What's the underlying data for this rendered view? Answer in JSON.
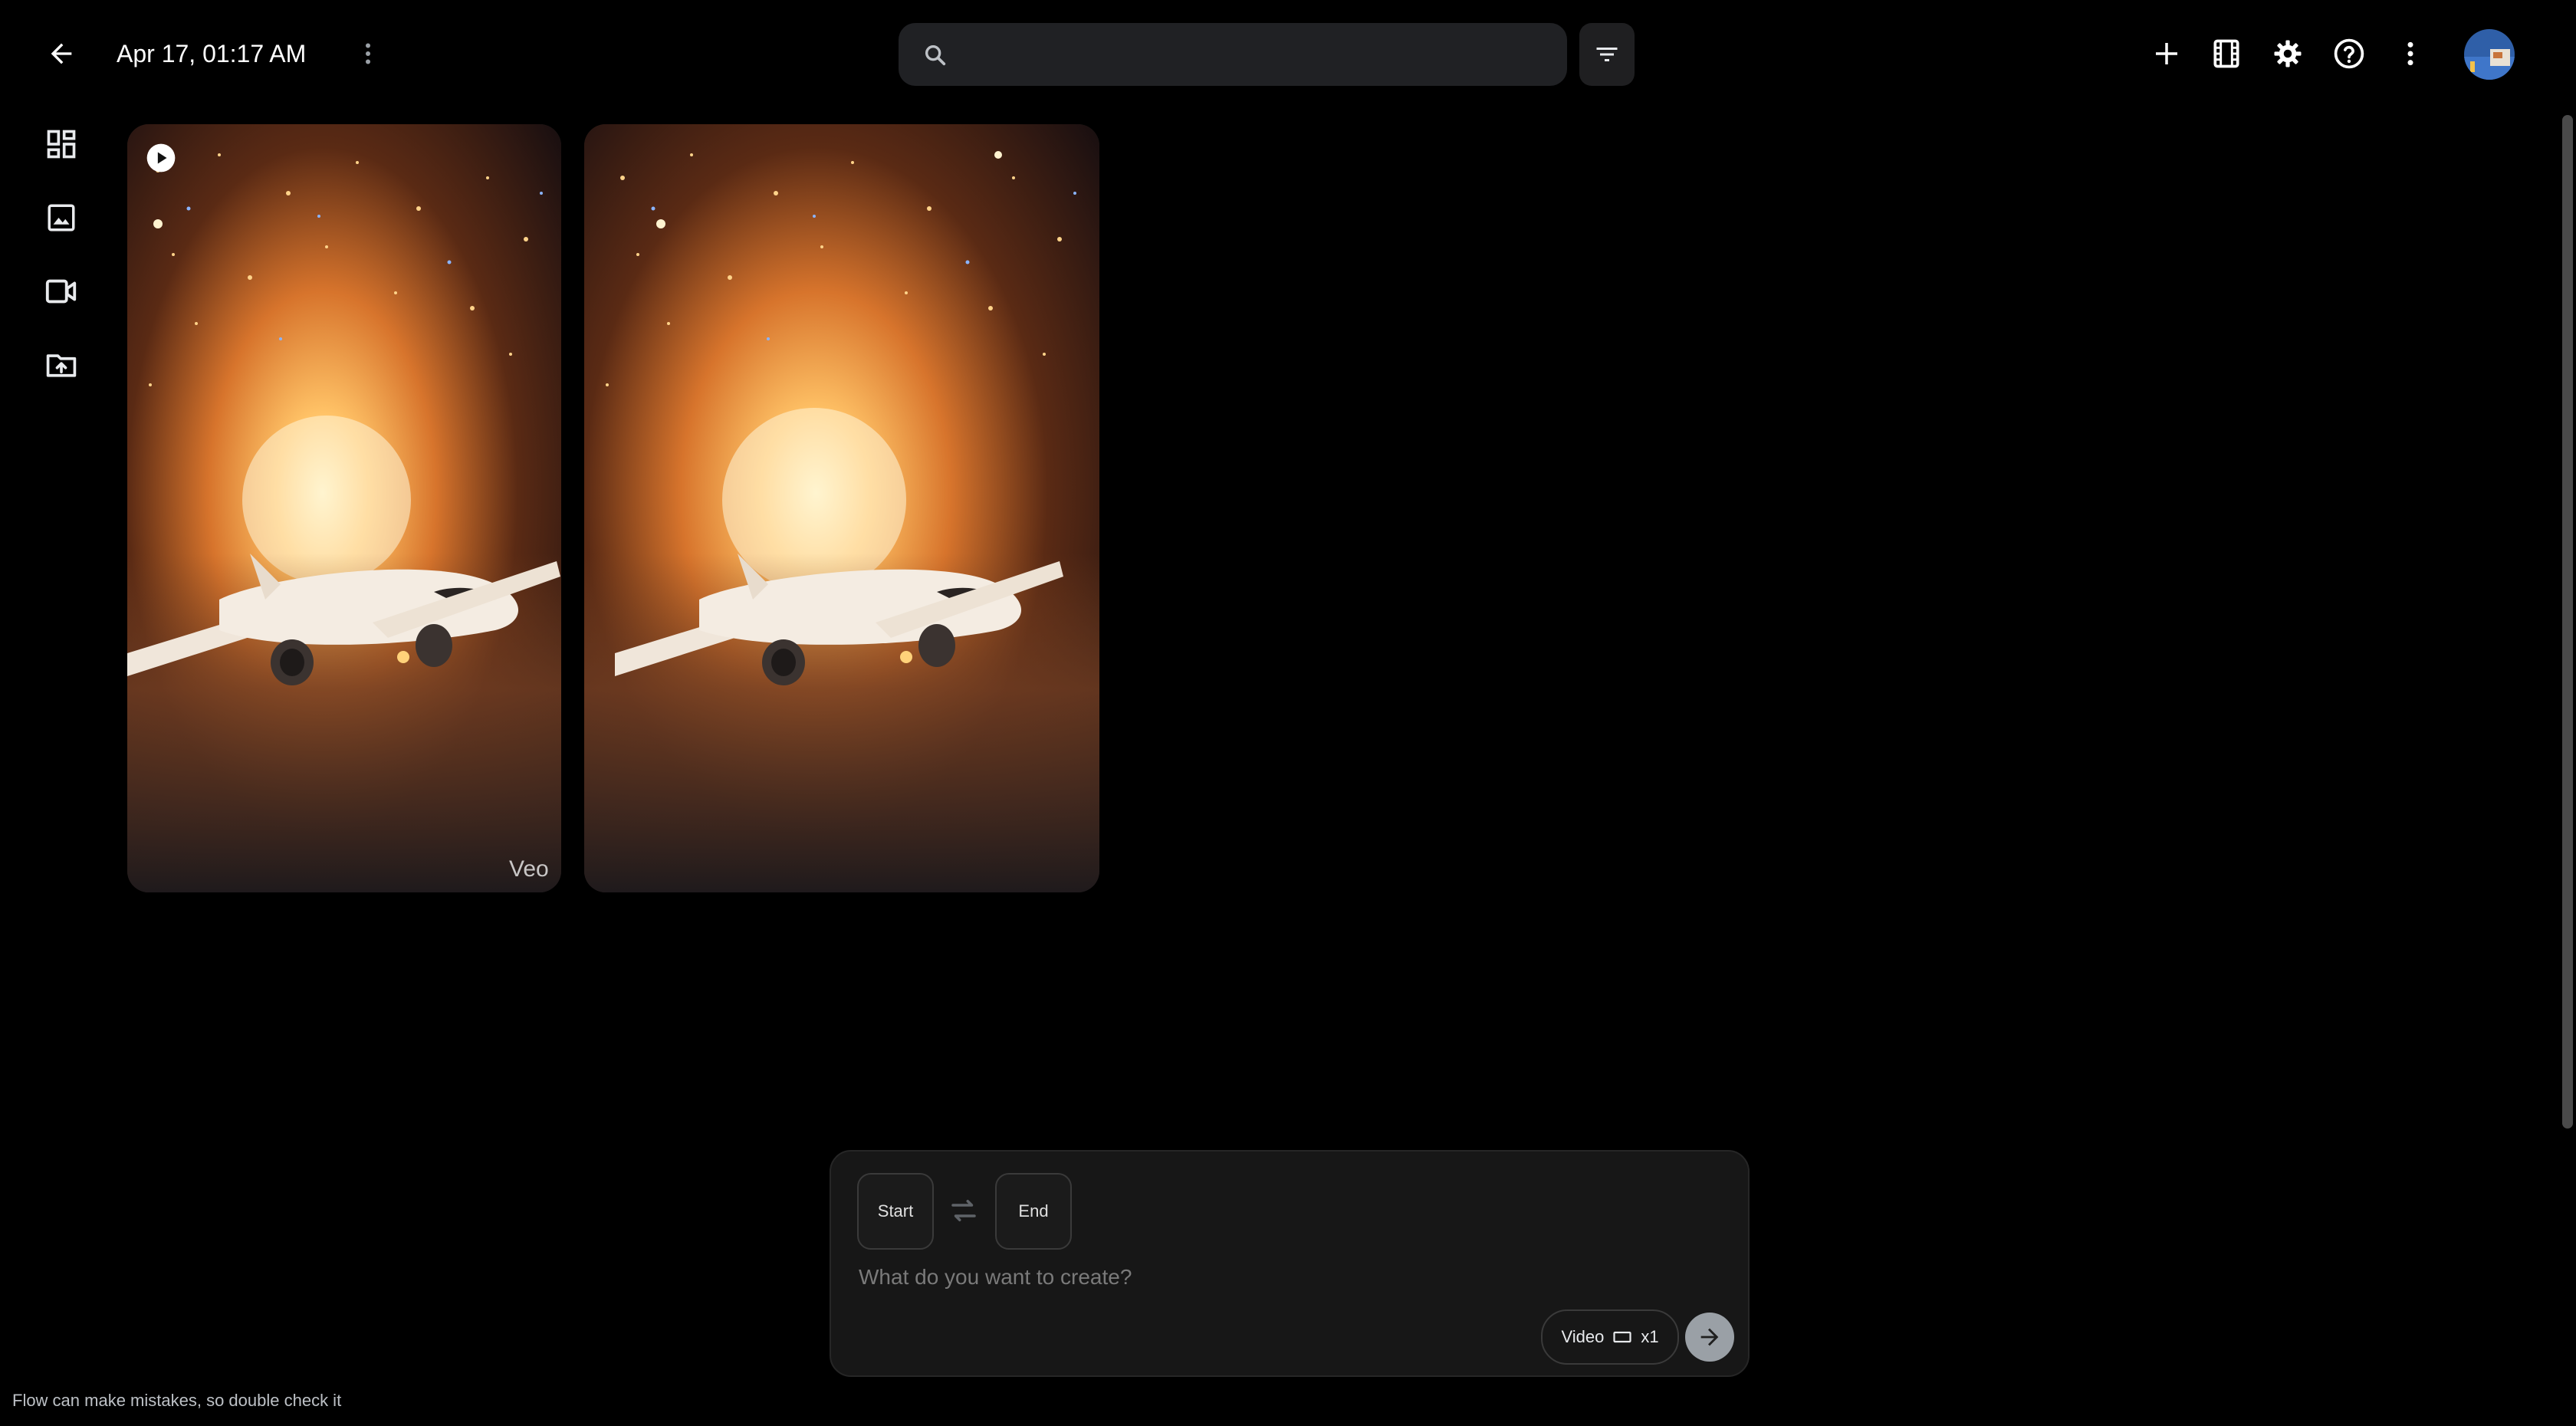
{
  "header": {
    "back_icon": "arrow-back-icon",
    "title": "Apr 17, 01:17 AM",
    "title_more_icon": "more-vert-icon",
    "search": {
      "placeholder": "",
      "value": "",
      "icon": "search-icon"
    },
    "filter_icon": "filter-icon",
    "actions": [
      "add-icon",
      "scenebuilder-icon",
      "settings-icon",
      "help-icon",
      "more-vert-icon"
    ],
    "avatar_icon": "user-avatar"
  },
  "sidebar": {
    "items": [
      {
        "icon": "dashboard-icon"
      },
      {
        "icon": "image-icon"
      },
      {
        "icon": "videocam-icon"
      },
      {
        "icon": "upload-folder-icon"
      }
    ]
  },
  "media": {
    "items": [
      {
        "badge_icon": "play-icon",
        "watermark": "Veo"
      },
      {
        "badge_icon": "",
        "watermark": ""
      }
    ]
  },
  "composer": {
    "start_label": "Start",
    "end_label": "End",
    "swap_icon": "swap-icon",
    "prompt_placeholder": "What do you want to create?",
    "prompt_value": "",
    "mode_label": "Video",
    "aspect_icon": "landscape-aspect-icon",
    "count_label": "x1",
    "send_icon": "arrow-forward-icon"
  },
  "footer": {
    "disclaimer": "Flow can make mistakes, so double check it"
  },
  "colors": {
    "background": "#000000",
    "surface": "#202124",
    "composer": "#171717",
    "send_button": "#9aa0a6",
    "glow": "#f4a450"
  }
}
